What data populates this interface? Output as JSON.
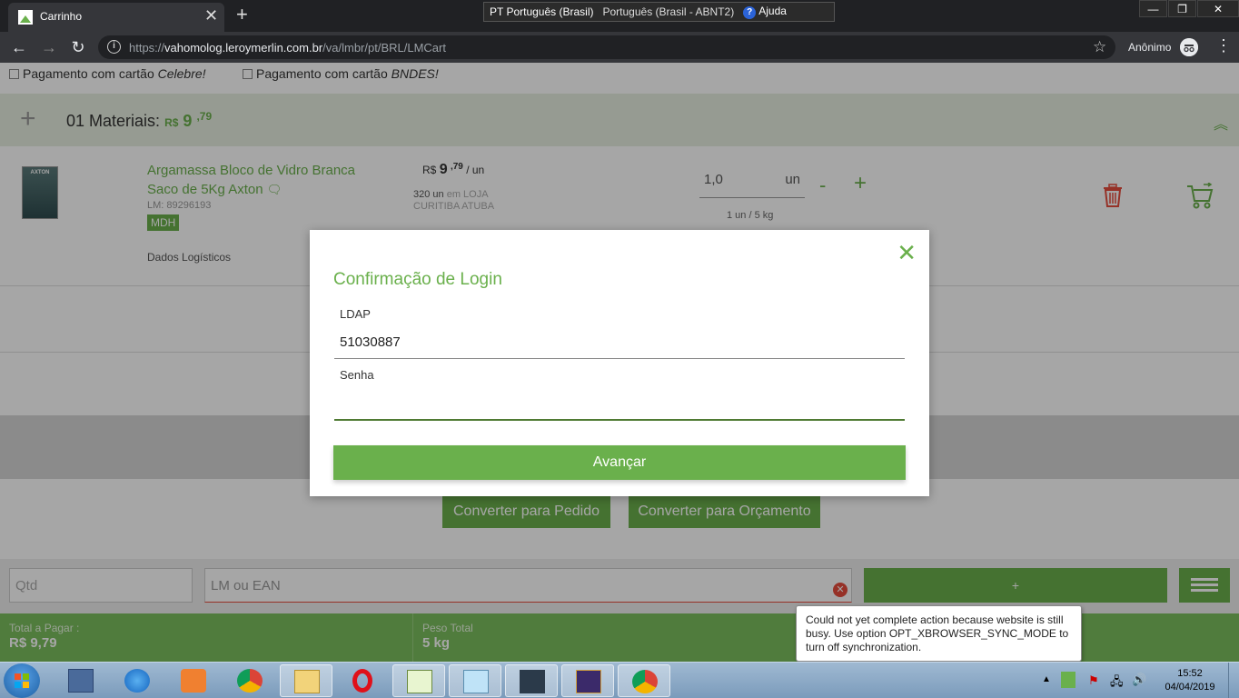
{
  "browser": {
    "tab_title": "Carrinho",
    "tab_close": "✕",
    "new_tab": "+",
    "url_prefix": "https://",
    "url_host": "vahomolog.leroymerlin.com.br",
    "url_path": "/va/lmbr/pt/BRL/LMCart",
    "profile_name": "Anônimo",
    "lang": "PT Português (Brasil)",
    "keyboard": "Português (Brasil - ABNT2)",
    "help": "Ajuda"
  },
  "payment_options": [
    {
      "prefix": "Pagamento com cartão ",
      "name": "Celebre!"
    },
    {
      "prefix": "Pagamento com cartão ",
      "name": "BNDES!"
    }
  ],
  "materials": {
    "title": "01 Materiais:",
    "currency": "R$",
    "price_int": "9",
    "price_dec": ",79"
  },
  "product": {
    "name": "Argamassa Bloco de Vidro Branca Saco de 5Kg Axton",
    "brand_label": "AXTON",
    "lm": "LM:  89296193",
    "badge": "MDH",
    "logistics": "Dados Logísticos",
    "currency": "R$",
    "price_int": "9",
    "price_dec": ",79",
    "per_unit": "/ un",
    "stock_qty": "320 un",
    "stock_where": "em LOJA",
    "stock_store": "CURITIBA ATUBA",
    "qty_value": "1,0",
    "qty_unit": "un",
    "qty_ratio": "1 un / 5 kg"
  },
  "actions": {
    "convert_order": "Converter para Pedido",
    "convert_quote": "Converter para Orçamento"
  },
  "entry": {
    "qtd_placeholder": "Qtd",
    "lm_placeholder": "LM ou EAN",
    "add_label": "+"
  },
  "totals": {
    "to_pay_label": "Total a Pagar :",
    "to_pay_value": "R$ 9,79",
    "weight_label": "Peso Total",
    "weight_value": "5  kg"
  },
  "modal": {
    "title": "Confirmação de Login",
    "ldap_label": "LDAP",
    "ldap_value": "51030887",
    "password_label": "Senha",
    "password_value": "",
    "submit": "Avançar"
  },
  "tooltip": {
    "text": "Could not yet complete action because website is still busy. Use option OPT_XBROWSER_SYNC_MODE to turn off synchronization."
  },
  "taskbar": {
    "time": "15:52",
    "date": "04/04/2019"
  },
  "colors": {
    "brand_green": "#6ab04c",
    "delete_red": "#e74c3c"
  }
}
